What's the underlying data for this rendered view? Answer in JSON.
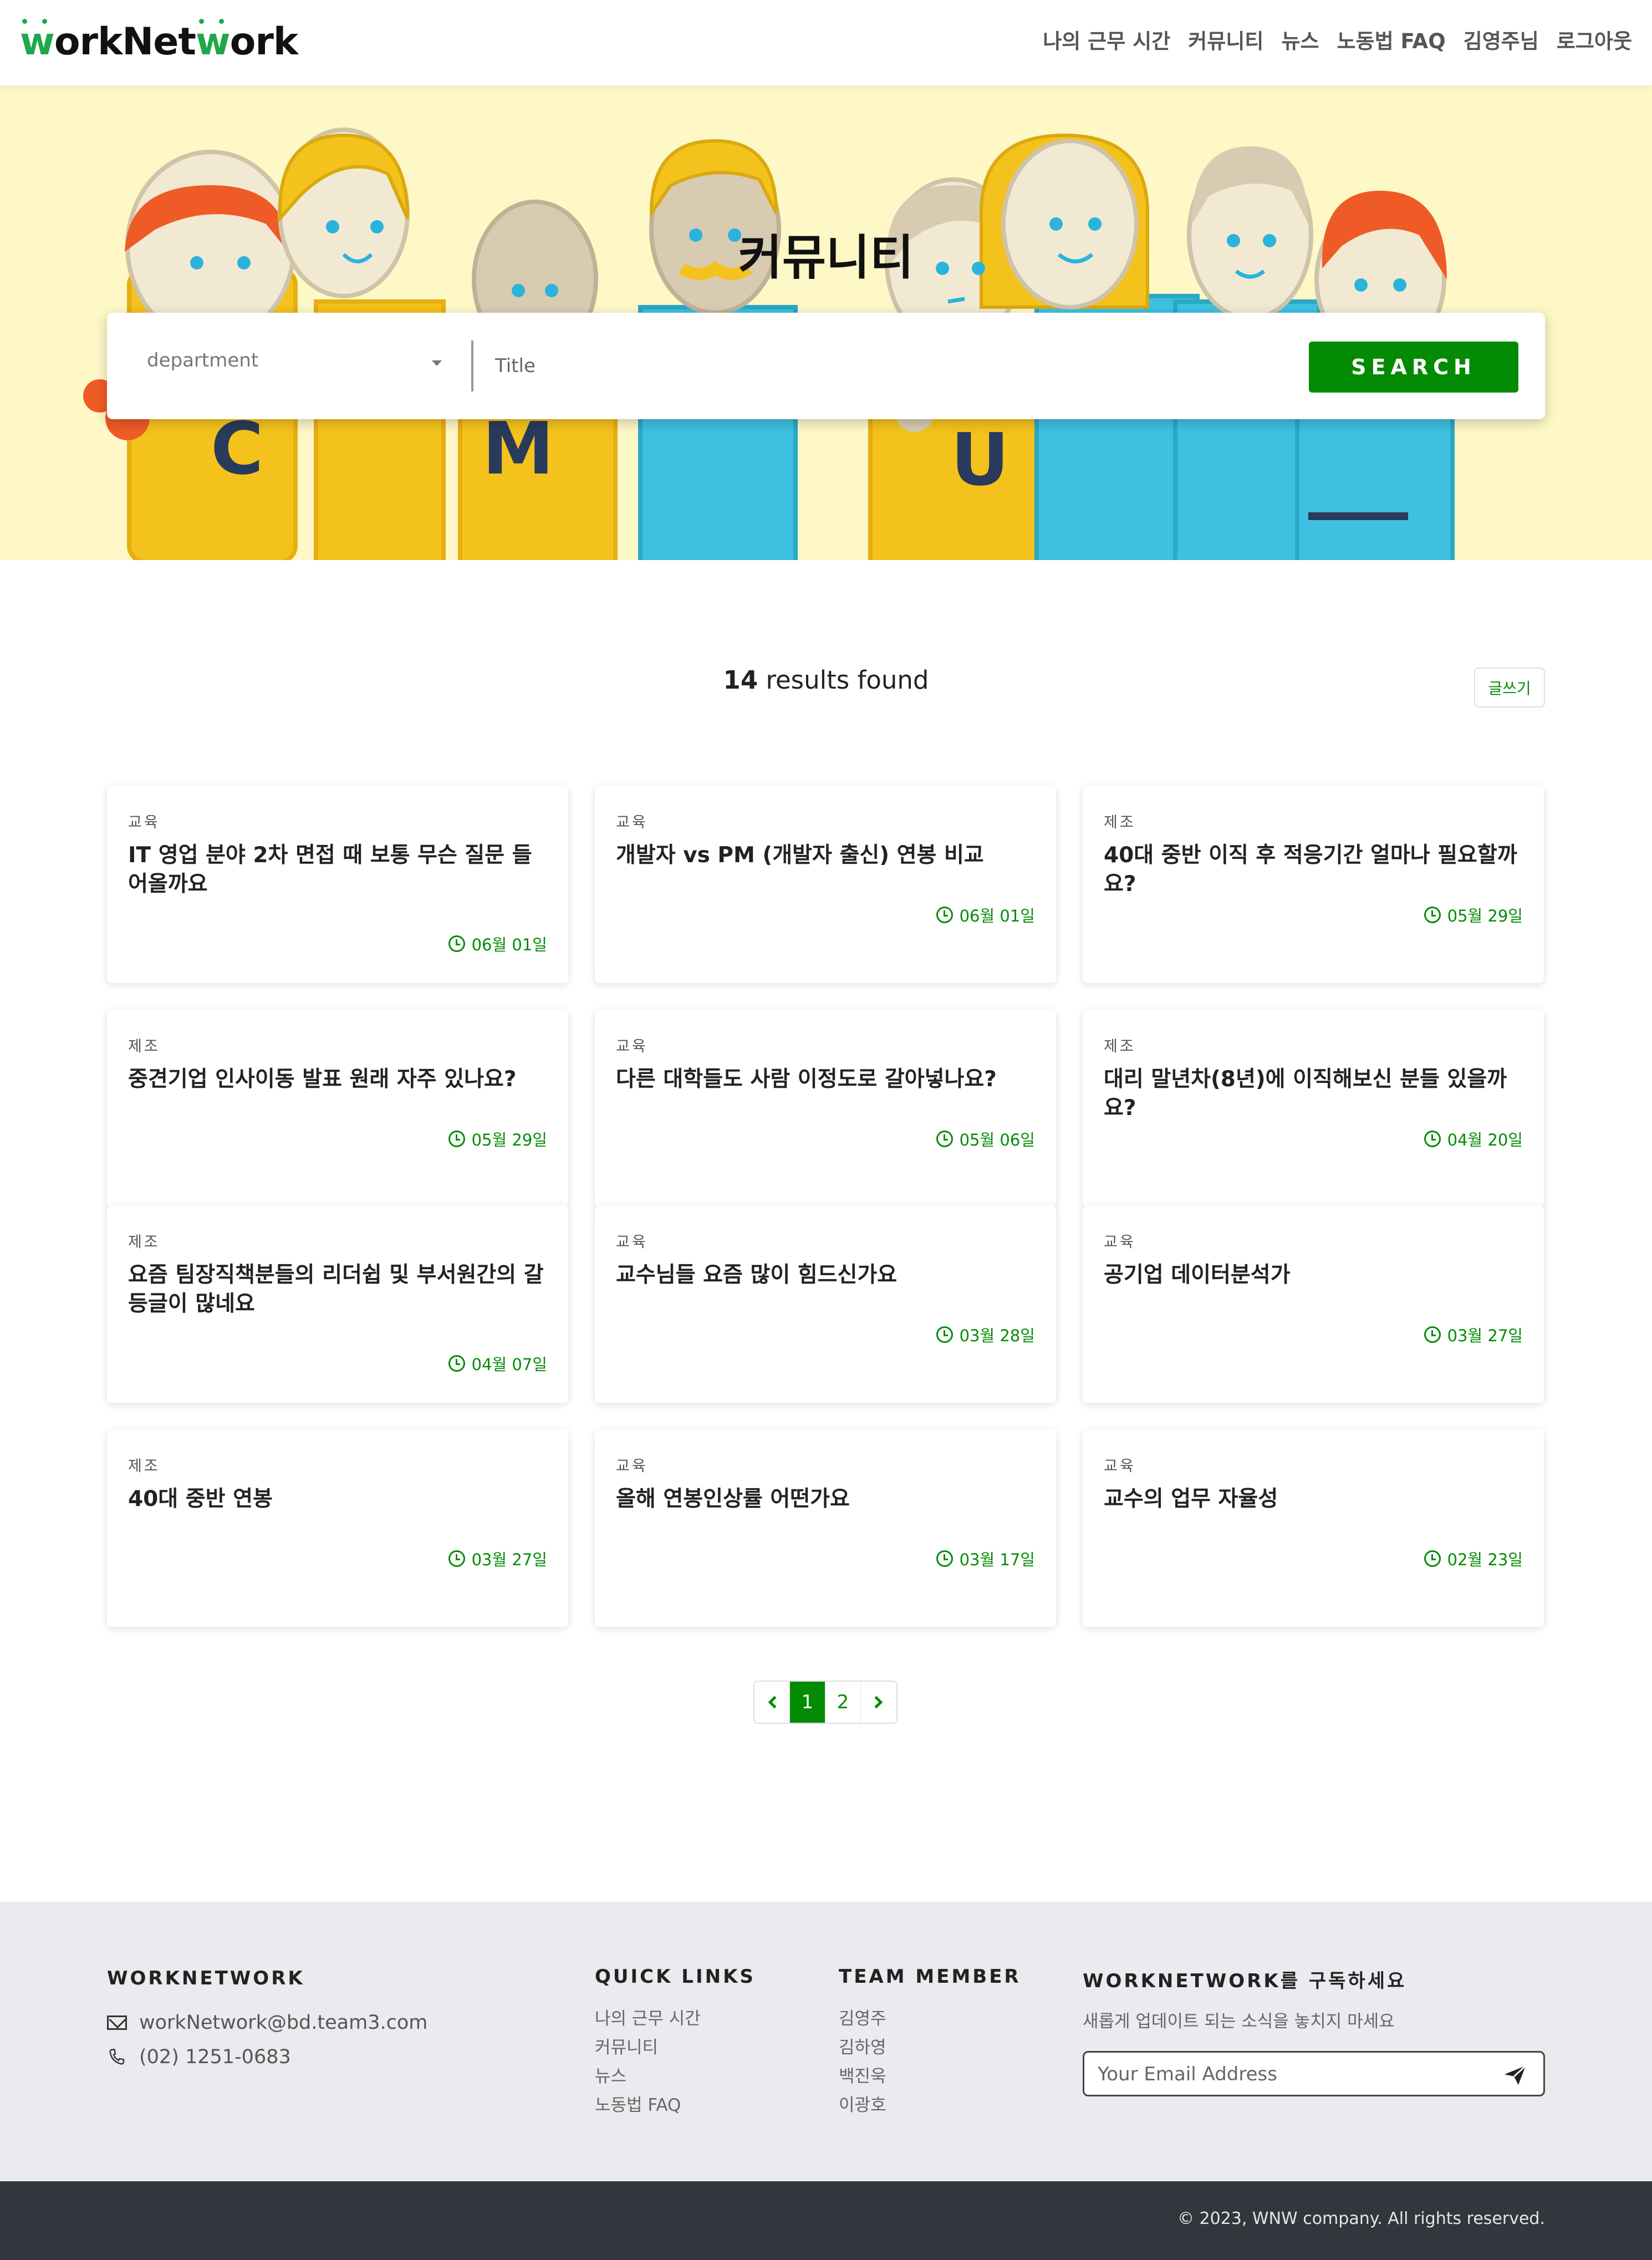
{
  "brand": {
    "logo_text_1": "w",
    "logo_text_2": "orkNet",
    "logo_text_3": "w",
    "logo_text_4": "ork",
    "accent": "#048b04",
    "logo_green": "#1ea84a"
  },
  "nav": [
    "나의 근무 시간",
    "커뮤니티",
    "뉴스",
    "노동법 FAQ",
    "김영주님",
    "로그아웃"
  ],
  "hero": {
    "title": "커뮤니티",
    "department_placeholder": "department",
    "title_placeholder": "Title",
    "search_label": "SEARCH",
    "background": "#fef7c6"
  },
  "results": {
    "count": "14",
    "suffix": " results found",
    "write_label": "글쓰기"
  },
  "posts": [
    {
      "category": "교육",
      "title": "IT 영업 분야 2차 면접 때 보통 무슨 질문 들어올까요",
      "date": "06월 01일"
    },
    {
      "category": "교육",
      "title": "개발자 vs PM (개발자 출신) 연봉 비교",
      "date": "06월 01일"
    },
    {
      "category": "제조",
      "title": "40대 중반 이직 후 적응기간 얼마나 필요할까요?",
      "date": "05월 29일"
    },
    {
      "category": "제조",
      "title": "중견기업 인사이동 발표 원래 자주 있나요?",
      "date": "05월 29일"
    },
    {
      "category": "교육",
      "title": "다른 대학들도 사람 이정도로 갈아넣나요?",
      "date": "05월 06일"
    },
    {
      "category": "제조",
      "title": "대리 말년차(8년)에 이직해보신 분들 있을까요?",
      "date": "04월 20일"
    },
    {
      "category": "제조",
      "title": "요즘 팀장직책분들의 리더쉽 및 부서원간의 갈등글이 많네요",
      "date": "04월 07일"
    },
    {
      "category": "교육",
      "title": "교수님들 요즘 많이 힘드신가요",
      "date": "03월 28일"
    },
    {
      "category": "교육",
      "title": "공기업 데이터분석가",
      "date": "03월 27일"
    },
    {
      "category": "제조",
      "title": "40대 중반 연봉",
      "date": "03월 27일"
    },
    {
      "category": "교육",
      "title": "올해 연봉인상률 어떤가요",
      "date": "03월 17일"
    },
    {
      "category": "교육",
      "title": "교수의 업무 자율성",
      "date": "02월 23일"
    }
  ],
  "pagination": {
    "pages": [
      "1",
      "2"
    ],
    "current": "1"
  },
  "footer": {
    "brand_heading": "WORKNETWORK",
    "email": "workNetwork@bd.team3.com",
    "phone": "(02) 1251-0683",
    "quick_links_heading": "QUICK LINKS",
    "quick_links": [
      "나의 근무 시간",
      "커뮤니티",
      "뉴스",
      "노동법 FAQ"
    ],
    "team_heading": "TEAM MEMBER",
    "team": [
      "김영주",
      "김하영",
      "백진욱",
      "이광호"
    ],
    "subscribe_heading": "WORKNETWORK를 구독하세요",
    "subscribe_desc": "새롭게 업데이트 되는 소식을 놓치지 마세요",
    "email_placeholder": "Your Email Address",
    "copyright": "© 2023, WNW company. All rights reserved."
  }
}
